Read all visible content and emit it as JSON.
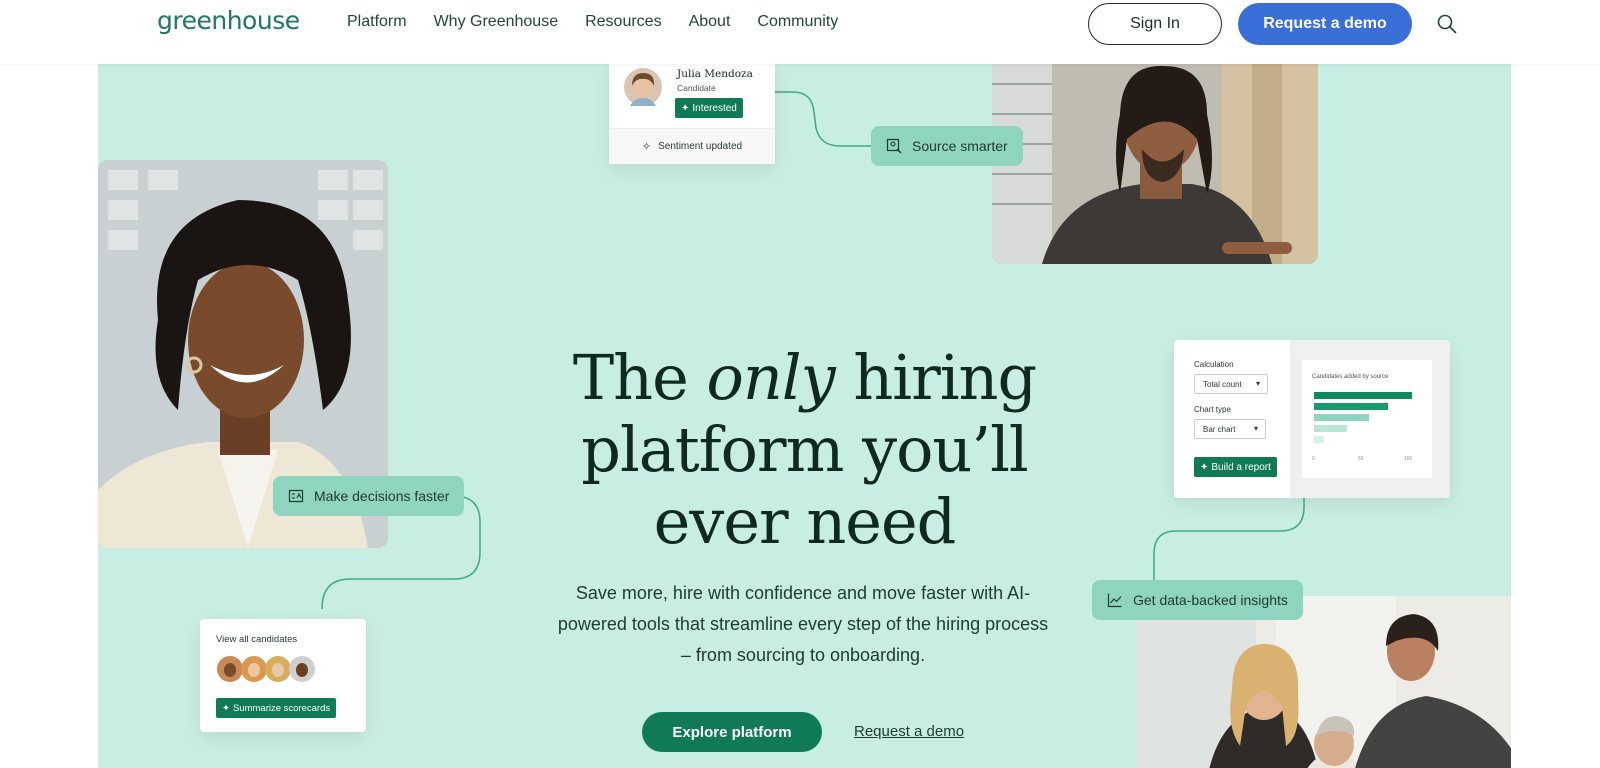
{
  "nav": {
    "logo": "greenhouse",
    "links": [
      "Platform",
      "Why Greenhouse",
      "Resources",
      "About",
      "Community"
    ],
    "sign_in": "Sign In",
    "request_demo": "Request a demo",
    "search_icon": "search-icon"
  },
  "hero": {
    "headline_part1": "The ",
    "headline_italic": "only",
    "headline_part2": " hiring",
    "headline_line2": "platform you’ll",
    "headline_line3": "ever need",
    "subtext": "Save more, hire with confidence and move faster with AI-powered tools that streamline every step of the hiring process – from sourcing to onboarding.",
    "explore_button": "Explore platform",
    "demo_link": "Request a demo"
  },
  "pills": {
    "source": "Source smarter",
    "decisions": "Make decisions faster",
    "insights": "Get data-backed insights"
  },
  "candidate_card": {
    "name": "Julia Mendoza",
    "role": "Candidate",
    "status": "Interested",
    "sentiment": "Sentiment updated"
  },
  "candidates_card": {
    "title": "View all candidates",
    "button": "Summarize scorecards"
  },
  "report_card": {
    "calc_label": "Calculation",
    "calc_value": "Total count",
    "chart_label": "Chart type",
    "chart_value": "Bar chart",
    "button": "Build a report",
    "chart_title": "Candidates added by source",
    "ticks": [
      "0",
      "50",
      "100"
    ],
    "bar_values": [
      100,
      76,
      56,
      34,
      10
    ]
  },
  "colors": {
    "accent_green": "#0f7a55",
    "hero_bg": "#c8ede2",
    "pill_bg": "#8fd4bf",
    "demo_blue": "#3a6fd8"
  }
}
